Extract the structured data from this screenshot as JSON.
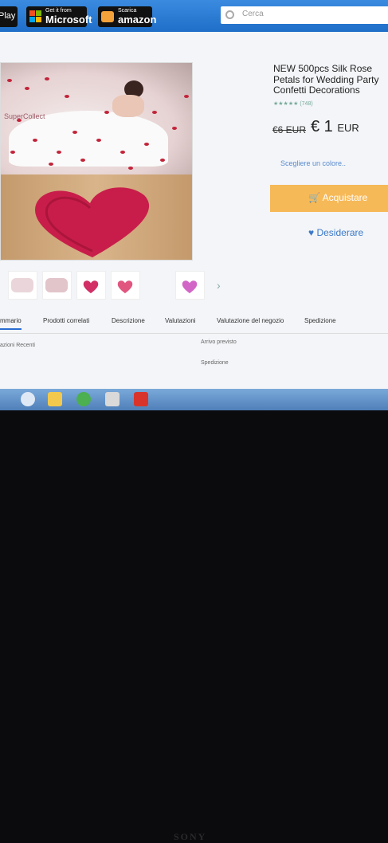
{
  "header": {
    "play_label": "Play",
    "microsoft": {
      "small": "Get it from",
      "big": "Microsoft"
    },
    "amazon": {
      "small": "Scarica",
      "big": "amazon"
    },
    "search_placeholder": "Cerca"
  },
  "product": {
    "title": "NEW 500pcs Silk Rose Petals for Wedding Party Confetti Decorations",
    "rating_text": "★★★★★ (748)",
    "old_price": "€6 EUR",
    "price": "€ 1",
    "currency": "EUR",
    "color_prompt": "Scegliere un colore..",
    "buy_label": "Acquistare",
    "wish_label": "Desiderare",
    "watermark": "SuperCollect"
  },
  "tabs": [
    {
      "label": "mmario"
    },
    {
      "label": "Prodotti correlati"
    },
    {
      "label": "Descrizione"
    },
    {
      "label": "Valutazioni"
    },
    {
      "label": "Valutazione del negozio"
    },
    {
      "label": "Spedizione"
    }
  ],
  "below": {
    "reviews_heading": "azioni Recenti",
    "arrival": "Arrivo previsto",
    "shipping": "Spedizione"
  },
  "colors": {
    "accent": "#f6b958",
    "topbar": "#2a7bd5",
    "heart": "#c81d4a"
  },
  "brand": "SONY"
}
